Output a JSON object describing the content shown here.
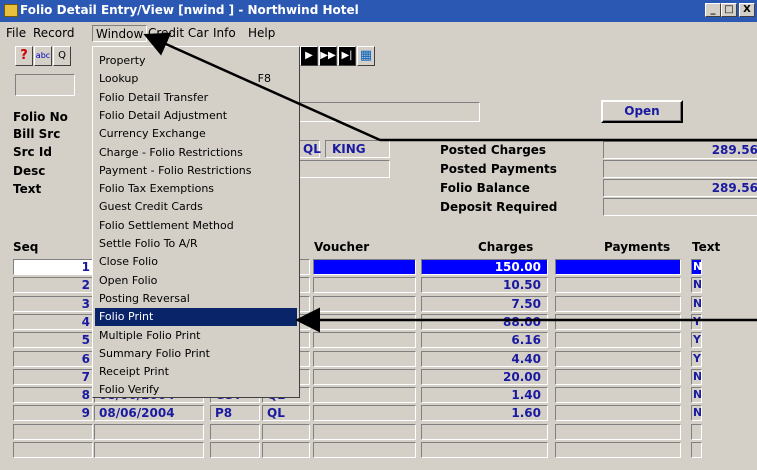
{
  "window": {
    "title": "Folio Detail Entry/View [nwind  ] - Northwind Hotel",
    "controls": [
      "_",
      "□",
      "X"
    ]
  },
  "menubar": [
    "File",
    "Record",
    "Window",
    "Credit Car",
    "Info",
    "Help"
  ],
  "toolbar": {
    "help_glyph": "?",
    "spell_glyph": "abc",
    "search_glyph": "Q"
  },
  "dropdown": {
    "items": [
      {
        "label": "Property",
        "shortcut": ""
      },
      {
        "label": "Lookup",
        "shortcut": "F8"
      },
      {
        "label": "Folio Detail Transfer",
        "shortcut": ""
      },
      {
        "label": "Folio Detail Adjustment",
        "shortcut": ""
      },
      {
        "label": "Currency Exchange",
        "shortcut": ""
      },
      {
        "label": "Charge - Folio Restrictions",
        "shortcut": ""
      },
      {
        "label": "Payment - Folio Restrictions",
        "shortcut": ""
      },
      {
        "label": "Folio Tax Exemptions",
        "shortcut": ""
      },
      {
        "label": "Guest Credit Cards",
        "shortcut": ""
      },
      {
        "label": "Folio Settlement Method",
        "shortcut": ""
      },
      {
        "label": "Settle Folio To A/R",
        "shortcut": ""
      },
      {
        "label": "Close Folio",
        "shortcut": ""
      },
      {
        "label": "Open Folio",
        "shortcut": ""
      },
      {
        "label": "Posting Reversal",
        "shortcut": ""
      },
      {
        "label": "Folio Print",
        "shortcut": ""
      },
      {
        "label": "Multiple Folio Print",
        "shortcut": ""
      },
      {
        "label": "Summary Folio Print",
        "shortcut": ""
      },
      {
        "label": "Receipt Print",
        "shortcut": ""
      },
      {
        "label": "Folio Verify",
        "shortcut": ""
      }
    ]
  },
  "form": {
    "labels": {
      "folio_no": "Folio No",
      "bill_src": "Bill Src",
      "src_id": "Src Id",
      "desc": "Desc",
      "text": "Text"
    },
    "src_id_code": "QL",
    "src_id_name": "KING",
    "open_button": "Open"
  },
  "summary": {
    "posted_charges_label": "Posted Charges",
    "posted_charges_value": "289.56",
    "posted_payments_label": "Posted Payments",
    "posted_payments_value": "",
    "folio_balance_label": "Folio Balance",
    "folio_balance_value": "289.56",
    "deposit_required_label": "Deposit Required",
    "deposit_required_value": ""
  },
  "grid": {
    "headers": {
      "seq": "Seq",
      "voucher": "Voucher",
      "charges": "Charges",
      "payments": "Payments",
      "text": "Text"
    },
    "rows": [
      {
        "seq": "1",
        "date": "",
        "code": "",
        "src": "",
        "charges": "150.00",
        "text": "N"
      },
      {
        "seq": "2",
        "date": "",
        "code": "",
        "src": "",
        "charges": "10.50",
        "text": "N"
      },
      {
        "seq": "3",
        "date": "",
        "code": "",
        "src": "",
        "charges": "7.50",
        "text": "N"
      },
      {
        "seq": "4",
        "date": "",
        "code": "",
        "src": "",
        "charges": "88.00",
        "text": "Y"
      },
      {
        "seq": "5",
        "date": "",
        "code": "",
        "src": "",
        "charges": "6.16",
        "text": "Y"
      },
      {
        "seq": "6",
        "date": "",
        "code": "",
        "src": "",
        "charges": "4.40",
        "text": "Y"
      },
      {
        "seq": "7",
        "date": "",
        "code": "",
        "src": "",
        "charges": "20.00",
        "text": "N"
      },
      {
        "seq": "8",
        "date": "08/06/2004",
        "code": "GST",
        "src": "QL",
        "charges": "1.40",
        "text": "N"
      },
      {
        "seq": "9",
        "date": "08/06/2004",
        "code": "P8",
        "src": "QL",
        "charges": "1.60",
        "text": "N"
      },
      {
        "seq": "",
        "date": "",
        "code": "",
        "src": "",
        "charges": "",
        "text": ""
      },
      {
        "seq": "",
        "date": "",
        "code": "",
        "src": "",
        "charges": "",
        "text": ""
      }
    ]
  },
  "colors": {
    "titlebar": "#2b58b3",
    "face": "#d4d0c8",
    "highlight": "#0000ff",
    "field_text": "#1a1aa0",
    "menu_selection": "#0a246a"
  }
}
